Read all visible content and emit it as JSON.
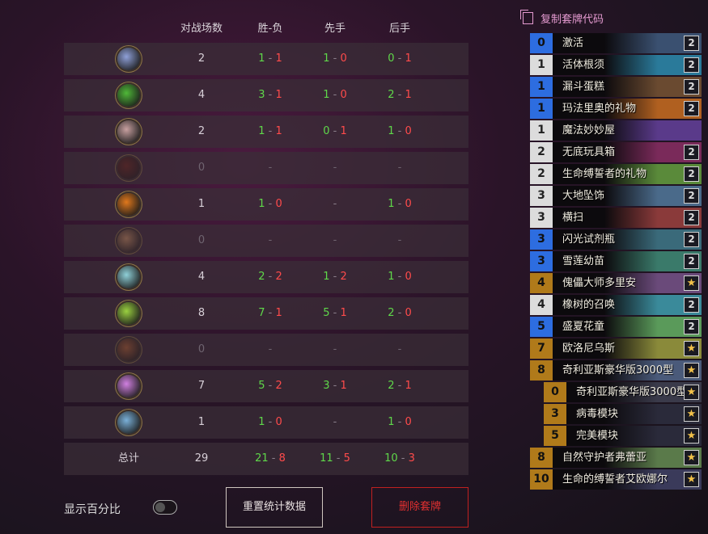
{
  "headers": {
    "games": "对战场数",
    "win_loss": "胜-负",
    "first": "先手",
    "second": "后手"
  },
  "rows": [
    {
      "icon": "mage-icon",
      "color": "#8fa0d8",
      "games": "2",
      "w": "1",
      "l": "1",
      "fw": "1",
      "fl": "0",
      "sw": "0",
      "sl": "1",
      "empty": false
    },
    {
      "icon": "hunter-icon",
      "color": "#4fb838",
      "games": "4",
      "w": "3",
      "l": "1",
      "fw": "1",
      "fl": "0",
      "sw": "2",
      "sl": "1",
      "empty": false
    },
    {
      "icon": "shaman-icon",
      "color": "#c8a0a0",
      "games": "2",
      "w": "1",
      "l": "1",
      "fw": "0",
      "fl": "1",
      "sw": "1",
      "sl": "0",
      "empty": false
    },
    {
      "icon": "deathknight-icon",
      "color": "#6a2418",
      "games": "0",
      "empty": true
    },
    {
      "icon": "warrior-icon",
      "color": "#e0781c",
      "games": "1",
      "w": "1",
      "l": "0",
      "fw": "-",
      "fl": "",
      "sw": "1",
      "sl": "0",
      "empty": false
    },
    {
      "icon": "rogue-icon",
      "color": "#c89060",
      "games": "0",
      "empty": true
    },
    {
      "icon": "paladin-icon",
      "color": "#8fd0d8",
      "games": "4",
      "w": "2",
      "l": "2",
      "fw": "1",
      "fl": "2",
      "sw": "1",
      "sl": "0",
      "empty": false
    },
    {
      "icon": "druid-icon",
      "color": "#9ad040",
      "games": "8",
      "w": "7",
      "l": "1",
      "fw": "5",
      "fl": "1",
      "sw": "2",
      "sl": "0",
      "empty": false
    },
    {
      "icon": "warlock-icon",
      "color": "#b06030",
      "games": "0",
      "empty": true
    },
    {
      "icon": "priest-icon",
      "color": "#d080e0",
      "games": "7",
      "w": "5",
      "l": "2",
      "fw": "3",
      "fl": "1",
      "sw": "2",
      "sl": "1",
      "empty": false
    },
    {
      "icon": "demonhunter-icon",
      "color": "#7ab0d8",
      "games": "1",
      "w": "1",
      "l": "0",
      "fw": "-",
      "fl": "",
      "sw": "1",
      "sl": "0",
      "empty": false
    }
  ],
  "total": {
    "label": "总计",
    "games": "29",
    "w": "21",
    "l": "8",
    "fw": "11",
    "fl": "5",
    "sw": "10",
    "sl": "3"
  },
  "show_percent_label": "显示百分比",
  "reset_button": "重置统计数据",
  "delete_button": "删除套牌",
  "copy_deck_code": "复制套牌代码",
  "cards": [
    {
      "cost": "0",
      "name": "激活",
      "qty": "2",
      "style": "blue",
      "art": "#3a5070"
    },
    {
      "cost": "1",
      "name": "活体根须",
      "qty": "2",
      "style": "n1",
      "art": "#2a7a9a"
    },
    {
      "cost": "1",
      "name": "漏斗蛋糕",
      "qty": "2",
      "style": "blue",
      "art": "#6a4a30"
    },
    {
      "cost": "1",
      "name": "玛法里奥的礼物",
      "qty": "2",
      "style": "blue",
      "art": "#b06020"
    },
    {
      "cost": "1",
      "name": "魔法妙妙屋",
      "qty": "",
      "style": "n1",
      "art": "#5a3a8a"
    },
    {
      "cost": "2",
      "name": "无底玩具箱",
      "qty": "2",
      "style": "n2",
      "art": "#7a2a5a"
    },
    {
      "cost": "2",
      "name": "生命缚誓者的礼物",
      "qty": "2",
      "style": "n2",
      "art": "#5a8a3a"
    },
    {
      "cost": "3",
      "name": "大地坠饰",
      "qty": "2",
      "style": "n3",
      "art": "#4a6a8a"
    },
    {
      "cost": "3",
      "name": "横扫",
      "qty": "2",
      "style": "n3",
      "art": "#8a3a3a"
    },
    {
      "cost": "3",
      "name": "闪光试剂瓶",
      "qty": "2",
      "style": "blue",
      "art": "#3a6a7a"
    },
    {
      "cost": "3",
      "name": "雪莲幼苗",
      "qty": "2",
      "style": "blue",
      "art": "#3a7a6a"
    },
    {
      "cost": "4",
      "name": "傀儡大师多里安",
      "qty": "★",
      "style": "gold",
      "art": "#6a4a7a"
    },
    {
      "cost": "4",
      "name": "橡树的召唤",
      "qty": "2",
      "style": "n4",
      "art": "#3a8a9a"
    },
    {
      "cost": "5",
      "name": "盛夏花童",
      "qty": "2",
      "style": "blue",
      "art": "#5a9a5a"
    },
    {
      "cost": "7",
      "name": "欧洛尼乌斯",
      "qty": "★",
      "style": "gold",
      "art": "#8a8a3a"
    },
    {
      "cost": "8",
      "name": "奇利亚斯豪华版3000型",
      "qty": "★",
      "style": "gold",
      "art": "#4a5a7a"
    },
    {
      "cost": "0",
      "name": "奇利亚斯豪华版3000型",
      "qty": "★",
      "style": "gold",
      "art": "#3a3a4a",
      "sub": true
    },
    {
      "cost": "3",
      "name": "病毒模块",
      "qty": "★",
      "style": "gold",
      "art": "#2a2a3a",
      "sub": true
    },
    {
      "cost": "5",
      "name": "完美模块",
      "qty": "★",
      "style": "gold",
      "art": "#2a2a3a",
      "sub": true
    },
    {
      "cost": "8",
      "name": "自然守护者弗蕾亚",
      "qty": "★",
      "style": "gold",
      "art": "#5a7a4a"
    },
    {
      "cost": "10",
      "name": "生命的缚誓者艾欧娜尔",
      "qty": "★",
      "style": "gold",
      "art": "#3a3a5a"
    }
  ]
}
